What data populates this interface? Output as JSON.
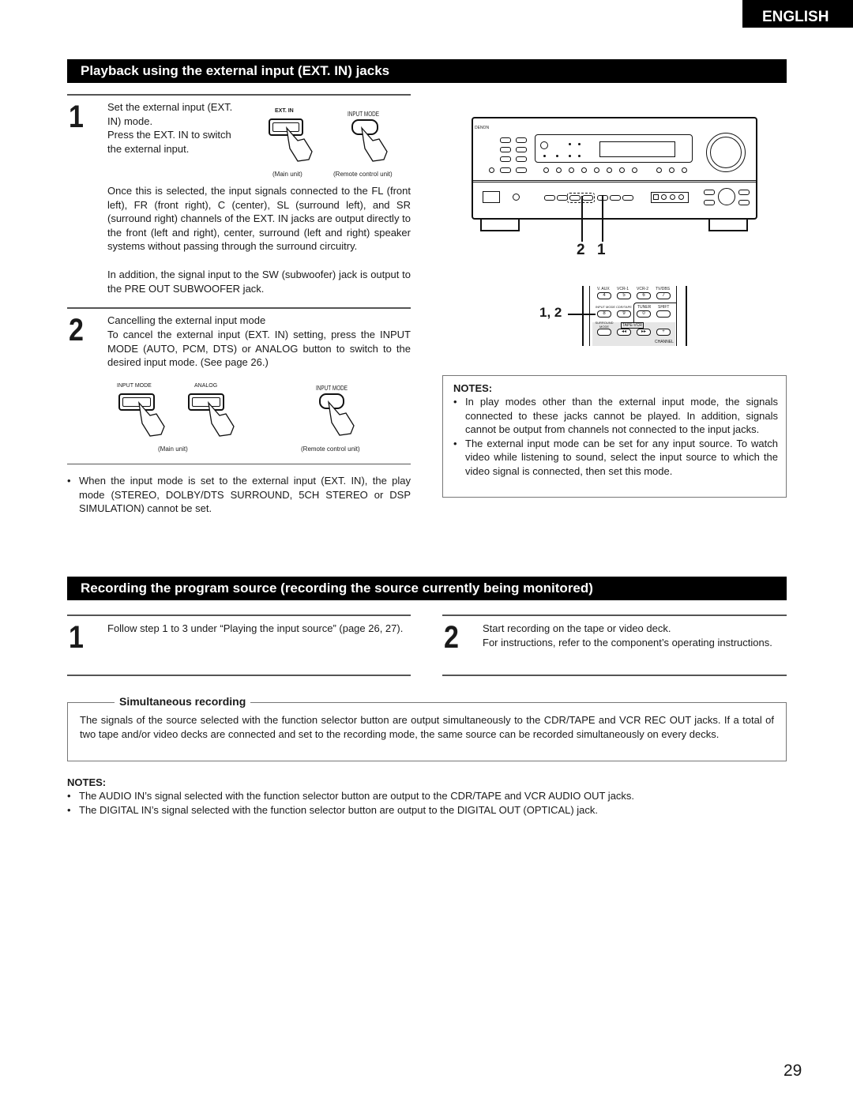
{
  "language_tab": "ENGLISH",
  "section1": {
    "title": "Playback using the external input (EXT. IN) jacks",
    "step1": {
      "number": "1",
      "lines": [
        "Set the external input (EXT.",
        "IN) mode.",
        "Press the EXT. IN to switch",
        "the external input."
      ],
      "illustration": {
        "main_button_label": "EXT. IN",
        "remote_button_label": "INPUT MODE",
        "main_caption": "(Main unit)",
        "remote_caption": "(Remote control unit)"
      },
      "paragraph1": "Once this is selected, the input signals connected to the FL (front left), FR (front right), C (center), SL (surround left), and SR (surround right) channels of the EXT. IN jacks are output directly to the front (left and right), center, surround (left and right) speaker systems without passing through the surround circuitry.",
      "paragraph2": "In addition, the signal input to the SW (subwoofer) jack is output to the PRE OUT SUBWOOFER jack."
    },
    "step2": {
      "number": "2",
      "heading": "Cancelling the external input mode",
      "text": "To cancel the external input (EXT. IN) setting, press the INPUT MODE (AUTO, PCM, DTS) or ANALOG button to switch to the desired input mode. (See page 26.)",
      "illustration": {
        "main_button1_label": "INPUT MODE",
        "main_button2_label": "ANALOG",
        "remote_button_label": "INPUT MODE",
        "main_caption": "(Main unit)",
        "remote_caption": "(Remote control unit)"
      }
    },
    "bullet_note": "When the input mode is set to the external input (EXT. IN), the play mode (STEREO, DOLBY/DTS SURROUND, 5CH STEREO or DSP SIMULATION) cannot be set.",
    "receiver": {
      "brand": "DENON",
      "callout_left": "2",
      "callout_right": "1"
    },
    "remote": {
      "callout": "1, 2",
      "row1_labels": [
        "V. AUX",
        "VCR-1",
        "VCR-2",
        "TV/DBS"
      ],
      "row1_keys": [
        "4",
        "5",
        "6",
        "7"
      ],
      "row2_labels": [
        "INPUT MODE",
        "CDR/TAPE",
        "TUNER",
        "SHIFT"
      ],
      "row2_keys": [
        "8",
        "9",
        "0",
        ""
      ],
      "row3_labels": [
        "SURROUND MODE",
        "TAPE-VCR",
        "",
        ""
      ],
      "row3_keys": [
        "",
        "◂◂",
        "▸▸",
        "+"
      ],
      "channel_label": "CHANNEL"
    },
    "notes": {
      "title": "NOTES:",
      "items": [
        "In play modes other than the external input mode, the signals connected to these jacks cannot be played. In addition, signals cannot be output from channels not connected to the input jacks.",
        "The external input mode can be set for any input source. To watch video while listening to sound, select the input source to which the video signal is connected, then set this mode."
      ]
    }
  },
  "section2": {
    "title": "Recording the program source (recording the source currently being monitored)",
    "step1": {
      "number": "1",
      "text": "Follow step 1 to 3  under “Playing the input source” (page 26, 27)."
    },
    "step2": {
      "number": "2",
      "line1": "Start recording on the tape or video deck.",
      "line2": "For instructions, refer to the component’s operating instructions."
    },
    "simultaneous": {
      "title": "Simultaneous recording",
      "text": "The signals of the source selected with the function selector button are output simultaneously to the CDR/TAPE and VCR REC OUT jacks. If a total of two tape and/or video decks are connected and set to the recording mode, the same source can be recorded simultaneously on every decks."
    },
    "notes": {
      "title": "NOTES:",
      "items": [
        "The AUDIO IN’s signal selected with the function selector button are output to the CDR/TAPE and VCR AUDIO OUT jacks.",
        "The DIGITAL IN’s signal selected with the function selector button are output to the DIGITAL OUT (OPTICAL) jack."
      ]
    }
  },
  "page_number": "29"
}
